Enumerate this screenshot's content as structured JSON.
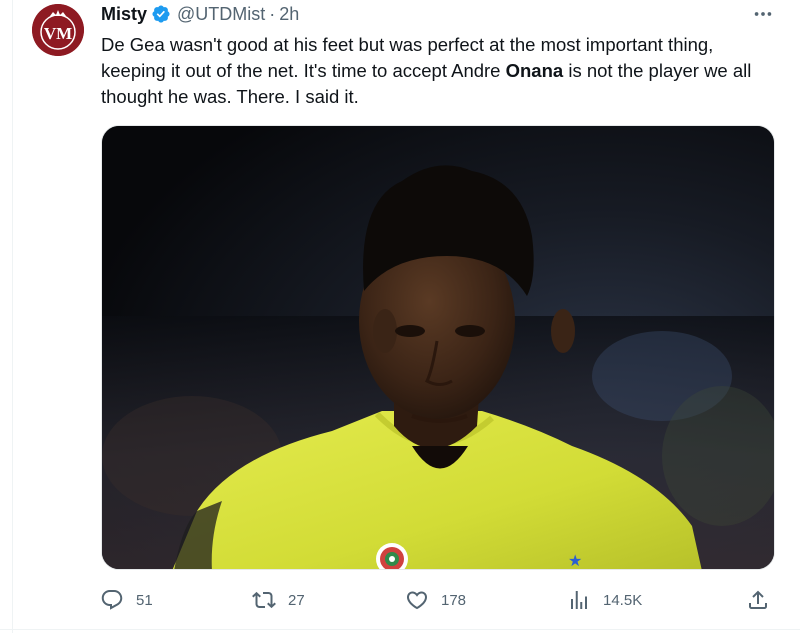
{
  "tweet": {
    "author": {
      "name": "Misty",
      "handle": "@UTDMist",
      "avatar_initials": "VM",
      "verified": true
    },
    "separator": "·",
    "time": "2h",
    "text_before": "De Gea wasn't good at his feet but was perfect at the most important thing, keeping it out of the net. It's time to accept Andre ",
    "text_bold": "Onana",
    "text_after": " is not the player we all thought he was. There. I said it.",
    "media": {
      "subject": "goalkeeper-in-yellow-jersey-photo"
    }
  },
  "actions": {
    "replies": "51",
    "retweets": "27",
    "likes": "178",
    "views": "14.5K"
  },
  "icons": {
    "more": "more-horizontal-icon",
    "reply": "reply-icon",
    "retweet": "retweet-icon",
    "like": "heart-icon",
    "views": "views-chart-icon",
    "share": "share-icon",
    "verified": "verified-badge-icon"
  },
  "colors": {
    "text": "#0f1419",
    "secondary": "#536471",
    "verified_blue": "#1d9bf0",
    "avatar_bg": "#8e1a22",
    "jersey_yellow": "#d8e23a"
  }
}
